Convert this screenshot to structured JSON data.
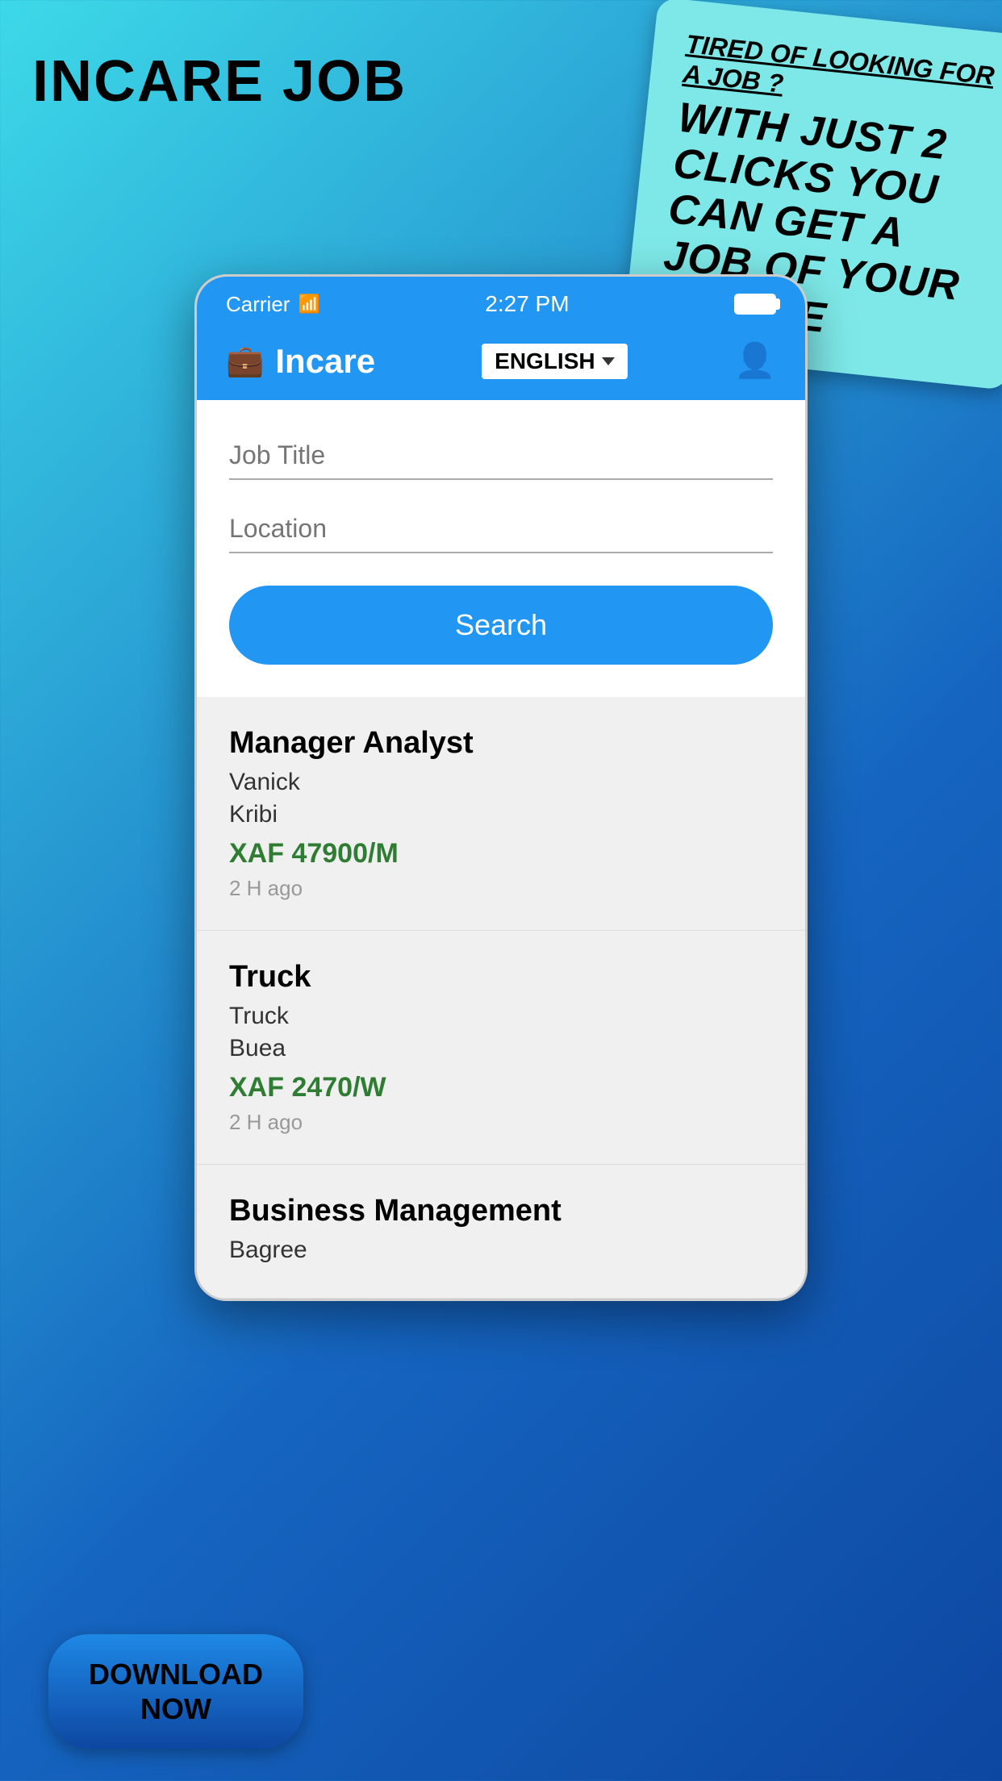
{
  "brand": {
    "title": "INCARE JOB"
  },
  "promo": {
    "line1": "TIRED OF LOOKING FOR A JOB ?",
    "main": "WITH JUST 2 CLICKS YOU CAN GET A JOB OF YOUR CHOICE"
  },
  "status_bar": {
    "carrier": "Carrier",
    "time": "2:27 PM"
  },
  "header": {
    "app_name": "Incare",
    "language": "ENGLISH",
    "language_icon": "chevron-down"
  },
  "search": {
    "job_title_placeholder": "Job Title",
    "location_placeholder": "Location",
    "button_label": "Search"
  },
  "jobs": [
    {
      "title": "Manager Analyst",
      "company": "Vanick",
      "location": "Kribi",
      "salary": "XAF 47900/M",
      "time_ago": "2 H ago"
    },
    {
      "title": "Truck",
      "company": "Truck",
      "location": "Buea",
      "salary": "XAF 2470/W",
      "time_ago": "2 H ago"
    },
    {
      "title": "Business Management",
      "company": "Bagree",
      "location": "",
      "salary": "",
      "time_ago": ""
    }
  ],
  "download_button": {
    "line1": "DOWNLOAD",
    "line2": "NOW"
  }
}
